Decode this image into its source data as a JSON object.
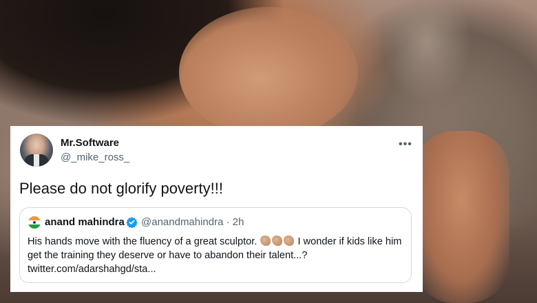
{
  "tweet": {
    "display_name": "Mr.Software",
    "handle": "@_mike_ross_",
    "text": "Please do not glorify poverty!!!",
    "more_icon": "more-horizontal-icon",
    "quoted": {
      "display_name": "anand mahindra",
      "handle_time": "@anandmahindra · 2h",
      "text_part1": "His hands move with the fluency of a great sculptor.",
      "text_part2": "I wonder if kids like him get the training they deserve or have to abandon their talent...?",
      "link": "twitter.com/adarshahgd/sta...",
      "emoji_icons": [
        "clap-icon",
        "clap-icon",
        "clap-icon"
      ],
      "verified_color": "#1d9bf0"
    }
  }
}
